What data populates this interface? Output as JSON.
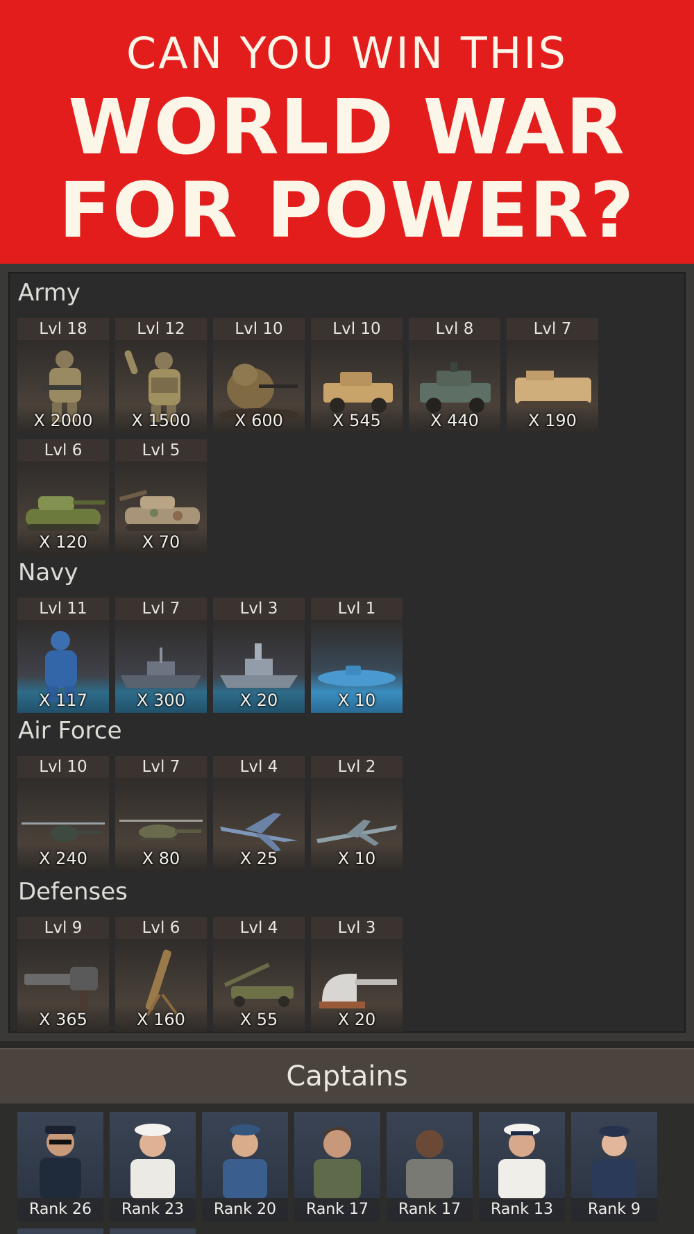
{
  "banner": {
    "line1": "CAN YOU WIN THIS",
    "line2": "WORLD WAR",
    "line3": "FOR POWER?"
  },
  "sections": {
    "army": {
      "title": "Army",
      "units": [
        {
          "level": "Lvl 18",
          "count": "X 2000",
          "icon": "infantry-soldier-icon"
        },
        {
          "level": "Lvl 12",
          "count": "X 1500",
          "icon": "grenadier-soldier-icon"
        },
        {
          "level": "Lvl 10",
          "count": "X 600",
          "icon": "sniper-ghillie-icon"
        },
        {
          "level": "Lvl 10",
          "count": "X 545",
          "icon": "humvee-icon"
        },
        {
          "level": "Lvl 8",
          "count": "X 440",
          "icon": "armored-humvee-icon"
        },
        {
          "level": "Lvl 7",
          "count": "X 190",
          "icon": "apc-icon"
        },
        {
          "level": "Lvl 6",
          "count": "X 120",
          "icon": "light-tank-icon"
        },
        {
          "level": "Lvl 5",
          "count": "X 70",
          "icon": "camo-tank-icon"
        }
      ]
    },
    "navy": {
      "title": "Navy",
      "units": [
        {
          "level": "Lvl 11",
          "count": "X 117",
          "icon": "navy-diver-icon"
        },
        {
          "level": "Lvl 7",
          "count": "X 300",
          "icon": "patrol-boat-icon"
        },
        {
          "level": "Lvl 3",
          "count": "X 20",
          "icon": "frigate-icon"
        },
        {
          "level": "Lvl 1",
          "count": "X 10",
          "icon": "submarine-icon"
        }
      ]
    },
    "air_force": {
      "title": "Air Force",
      "units": [
        {
          "level": "Lvl 10",
          "count": "X 240",
          "icon": "light-helicopter-icon"
        },
        {
          "level": "Lvl 7",
          "count": "X 80",
          "icon": "attack-helicopter-icon"
        },
        {
          "level": "Lvl 4",
          "count": "X 25",
          "icon": "fighter-jet-icon"
        },
        {
          "level": "Lvl 2",
          "count": "X 10",
          "icon": "strike-fighter-icon"
        }
      ]
    },
    "defenses": {
      "title": "Defenses",
      "units": [
        {
          "level": "Lvl 9",
          "count": "X 365",
          "icon": "gatling-gun-icon"
        },
        {
          "level": "Lvl 6",
          "count": "X 160",
          "icon": "mortar-icon"
        },
        {
          "level": "Lvl 4",
          "count": "X 55",
          "icon": "howitzer-icon"
        },
        {
          "level": "Lvl 3",
          "count": "X 20",
          "icon": "naval-turret-icon"
        }
      ]
    }
  },
  "captains": {
    "title": "Captains",
    "list": [
      {
        "rank": "Rank 26",
        "icon": "captain-sunglasses-avatar"
      },
      {
        "rank": "Rank 23",
        "icon": "captain-navy-white-female-avatar"
      },
      {
        "rank": "Rank 20",
        "icon": "captain-airforce-blue-avatar"
      },
      {
        "rank": "Rank 17",
        "icon": "captain-flight-suit-avatar"
      },
      {
        "rank": "Rank 17",
        "icon": "captain-camo-uniform-avatar"
      },
      {
        "rank": "Rank 13",
        "icon": "captain-navy-white-male-avatar"
      },
      {
        "rank": "Rank 9",
        "icon": "captain-female-officer-avatar"
      }
    ]
  },
  "colors": {
    "banner_red": "#e31c1c",
    "banner_text": "#fbf6e8",
    "panel_bg": "#2b2b2b",
    "level_header_bg": "#3b3330"
  }
}
